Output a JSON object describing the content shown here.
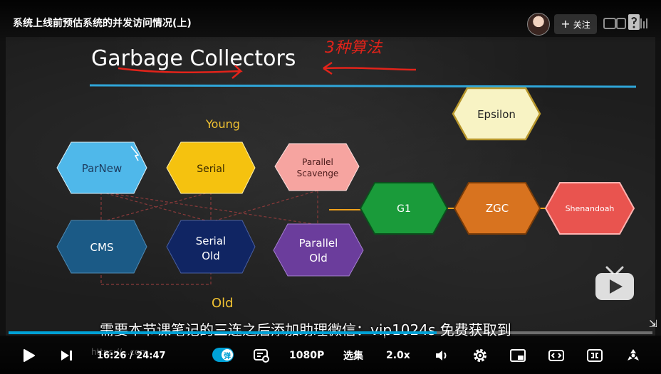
{
  "video": {
    "title": "系统上线前预估系统的并发访问情况(上)",
    "follow_label": "关注",
    "subtitle": "需要本节课笔记的三连之后添加助理微信：vip1024s 免费获取到",
    "progress_fraction": 0.665
  },
  "slide": {
    "title": "Garbage Collectors",
    "annotation": "3种算法",
    "young_label": "Young",
    "old_label": "Old",
    "collectors": {
      "parnew": "ParNew",
      "serial": "Serial",
      "parallel_scavenge_1": "Parallel",
      "parallel_scavenge_2": "Scavenge",
      "cms": "CMS",
      "serial_old_1": "Serial",
      "serial_old_2": "Old",
      "parallel_old_1": "Parallel",
      "parallel_old_2": "Old",
      "g1": "G1",
      "zgc": "ZGC",
      "shenandoah": "Shenandoah",
      "epsilon": "Epsilon"
    },
    "colors": {
      "parnew": "#4fb8ea",
      "serial": "#f5c20f",
      "parallel_scavenge": "#f6a4a0",
      "cms": "#1b5a86",
      "serial_old": "#102563",
      "parallel_old": "#6b3d9c",
      "g1": "#1a9b3a",
      "zgc": "#d8731f",
      "shenandoah": "#e9544f",
      "epsilon": "#f8f3c4",
      "accent_line": "#2fa6d9"
    }
  },
  "controls": {
    "time": "16:26 / 24:47",
    "ghost_url": "https://...com",
    "danmaku_label": "弹",
    "quality": "1080P",
    "episodes": "选集",
    "speed": "2.0x"
  },
  "icons": {
    "play": "play-icon",
    "next": "next-icon",
    "danmaku_settings": "danmaku-settings-icon",
    "volume": "volume-icon",
    "settings": "gear-icon",
    "pip": "picture-in-picture-icon",
    "widescreen": "widescreen-icon",
    "webfull": "web-fullscreen-icon",
    "fullscreen": "fullscreen-icon",
    "tv_play": "tv-play-icon"
  }
}
